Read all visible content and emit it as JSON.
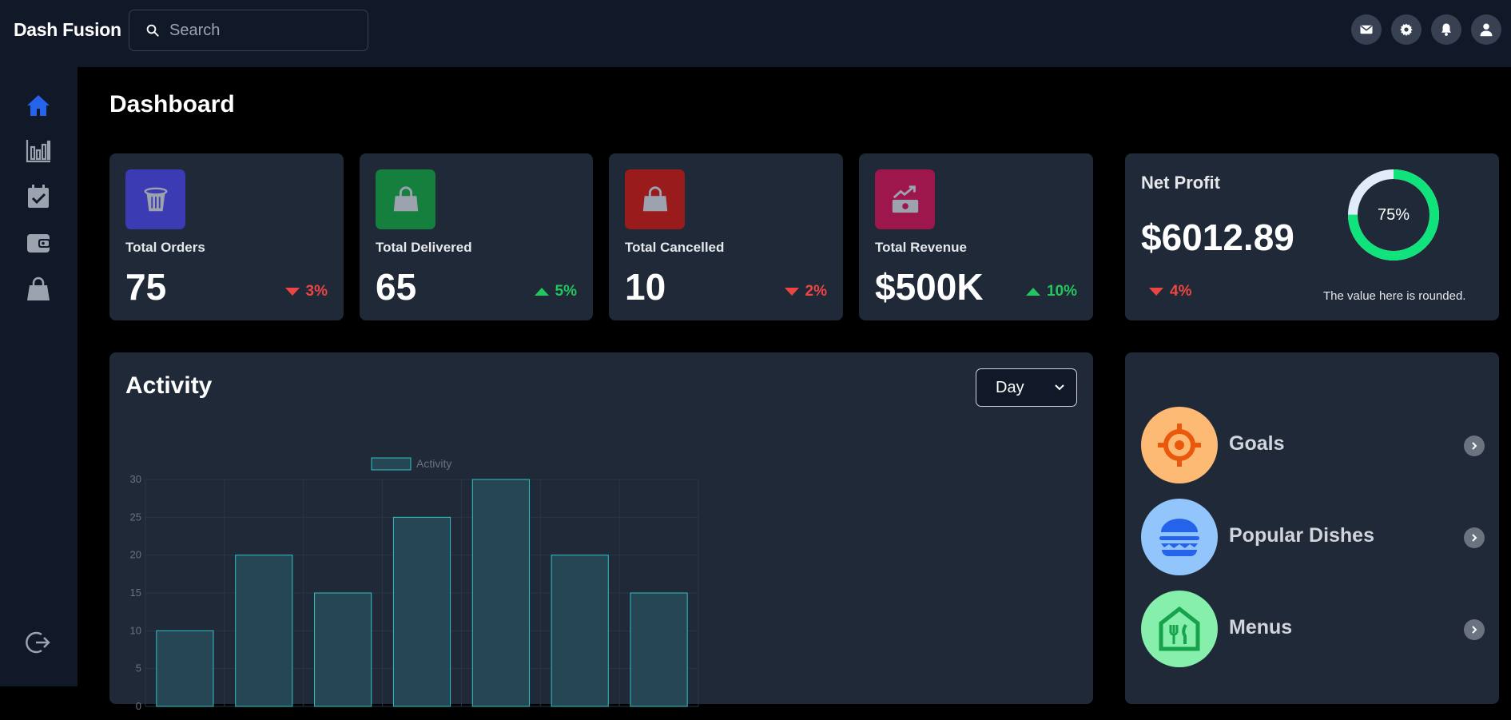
{
  "app": {
    "brand": "Dash Fusion"
  },
  "search": {
    "placeholder": "Search"
  },
  "topbar": {
    "icons": [
      "mail-icon",
      "settings-icon",
      "bell-icon",
      "user-icon"
    ]
  },
  "sidebar": {
    "items": [
      "home-icon",
      "chart-icon",
      "calendar-check-icon",
      "wallet-icon",
      "shopping-bag-icon"
    ],
    "active": "home-icon",
    "logout": "logout-icon"
  },
  "page": {
    "title": "Dashboard"
  },
  "stats": [
    {
      "label": "Total Orders",
      "value": "75",
      "trend": "3%",
      "direction": "down",
      "icon": "basket-icon",
      "color": "#3b3bb3"
    },
    {
      "label": "Total Delivered",
      "value": "65",
      "trend": "5%",
      "direction": "up",
      "icon": "bag-icon",
      "color": "#15803d"
    },
    {
      "label": "Total Cancelled",
      "value": "10",
      "trend": "2%",
      "direction": "down",
      "icon": "bag-icon",
      "color": "#991b1b"
    },
    {
      "label": "Total Revenue",
      "value": "$500K",
      "trend": "10%",
      "direction": "up",
      "icon": "money-growth-icon",
      "color": "#9d174d"
    }
  ],
  "net_profit": {
    "title": "Net Profit",
    "value": "$6012.89",
    "trend": "4%",
    "direction": "down",
    "percent_label": "75%",
    "percent": 75,
    "note": "The value here is rounded."
  },
  "activity": {
    "title": "Activity",
    "period": "Day"
  },
  "chart_data": {
    "type": "bar",
    "legend": "Activity",
    "legend_position": "top",
    "values": [
      10,
      20,
      15,
      25,
      30,
      20,
      15
    ],
    "yticks": [
      "30",
      "25",
      "20",
      "15",
      "10",
      "5",
      "0"
    ],
    "ylim": [
      0,
      30
    ],
    "grid": true,
    "colors": {
      "fill": "#264653",
      "stroke": "#2ec4c4"
    }
  },
  "links": [
    {
      "label": "Goals",
      "icon": "target-icon",
      "bg": "#fdba74",
      "fg": "#ea580c"
    },
    {
      "label": "Popular Dishes",
      "icon": "burger-icon",
      "bg": "#93c5fd",
      "fg": "#2563eb"
    },
    {
      "label": "Menus",
      "icon": "menu-restaurant-icon",
      "bg": "#86efac",
      "fg": "#16a34a"
    }
  ],
  "colors": {
    "accent": "#2563eb",
    "card": "#1f2937",
    "sidebar": "#111827",
    "donut": "#10e37c"
  }
}
